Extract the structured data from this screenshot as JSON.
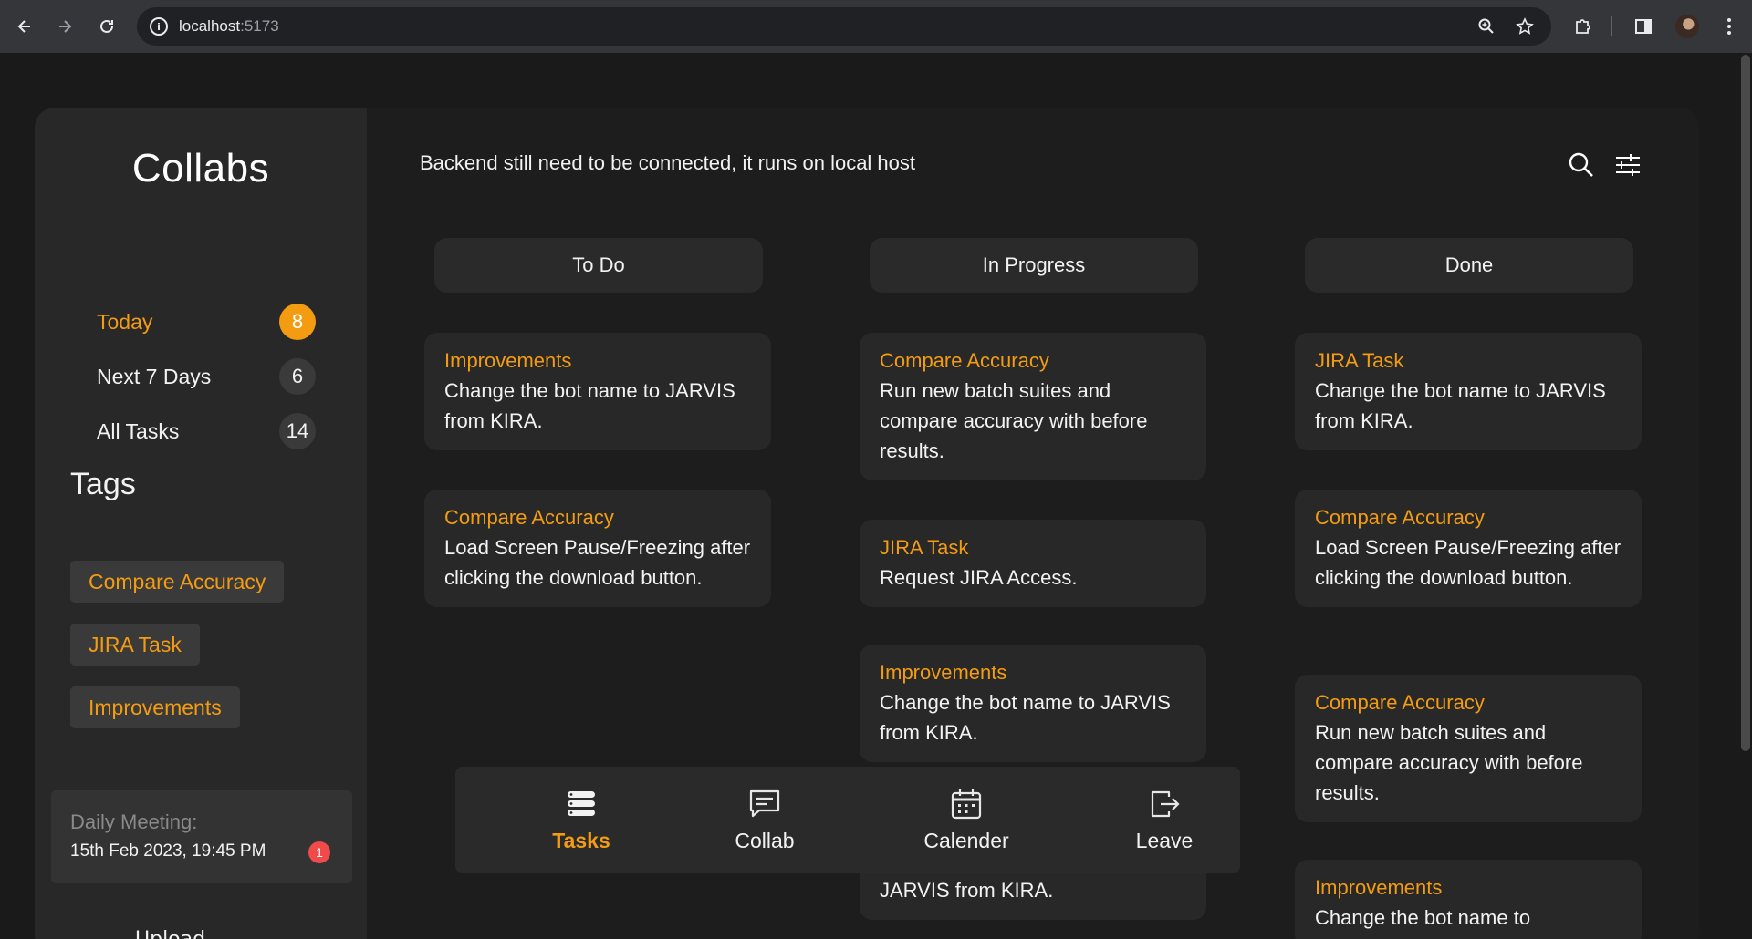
{
  "browser": {
    "url_host": "localhost",
    "url_port": ":5173"
  },
  "sidebar": {
    "logo": "Collabs",
    "filters": [
      {
        "label": "Today",
        "count": "8"
      },
      {
        "label": "Next 7 Days",
        "count": "6"
      },
      {
        "label": "All Tasks",
        "count": "14"
      }
    ],
    "tags_title": "Tags",
    "tags": [
      "Compare Accuracy",
      "JIRA Task",
      "Improvements"
    ],
    "meeting": {
      "label": "Daily Meeting:",
      "time": "15th Feb 2023, 19:45 PM",
      "badge": "1"
    },
    "cut_text": "Upload..."
  },
  "main": {
    "notice": "Backend still need to be connected, it runs on local host",
    "columns": [
      {
        "title": "To Do",
        "cards": [
          {
            "tag": "Improvements",
            "text": "Change the bot name to JARVIS from KIRA."
          },
          {
            "tag": "Compare Accuracy",
            "text": "Load Screen Pause/Freezing after clicking the download button."
          }
        ]
      },
      {
        "title": "In Progress",
        "cards": [
          {
            "tag": "Compare Accuracy",
            "text": "Run new batch suites and compare accuracy with before results."
          },
          {
            "tag": "JIRA Task",
            "text": "Request JIRA Access."
          },
          {
            "tag": "Improvements",
            "text": "Change the bot name to JARVIS from KIRA."
          },
          {
            "tag": "",
            "text": "JARVIS from KIRA."
          }
        ]
      },
      {
        "title": "Done",
        "cards": [
          {
            "tag": "JIRA Task",
            "text": "Change the bot name to JARVIS from KIRA."
          },
          {
            "tag": "Compare Accuracy",
            "text": "Load Screen Pause/Freezing after clicking the download button."
          },
          {
            "tag": "Compare Accuracy",
            "text": "Run new batch suites and compare accuracy with before results."
          },
          {
            "tag": "Improvements",
            "text": "Change the bot name to"
          }
        ]
      }
    ]
  },
  "bottom_nav": {
    "items": [
      {
        "label": "Tasks",
        "icon": "tasks-icon"
      },
      {
        "label": "Collab",
        "icon": "chat-icon"
      },
      {
        "label": "Calender",
        "icon": "calendar-icon"
      },
      {
        "label": "Leave",
        "icon": "logout-icon"
      }
    ],
    "active": "Tasks"
  },
  "colors": {
    "accent": "#f39c12",
    "background": "#1a1a1a",
    "sidebar": "#282828",
    "card": "#282828",
    "badge_red": "#f04a4a"
  }
}
